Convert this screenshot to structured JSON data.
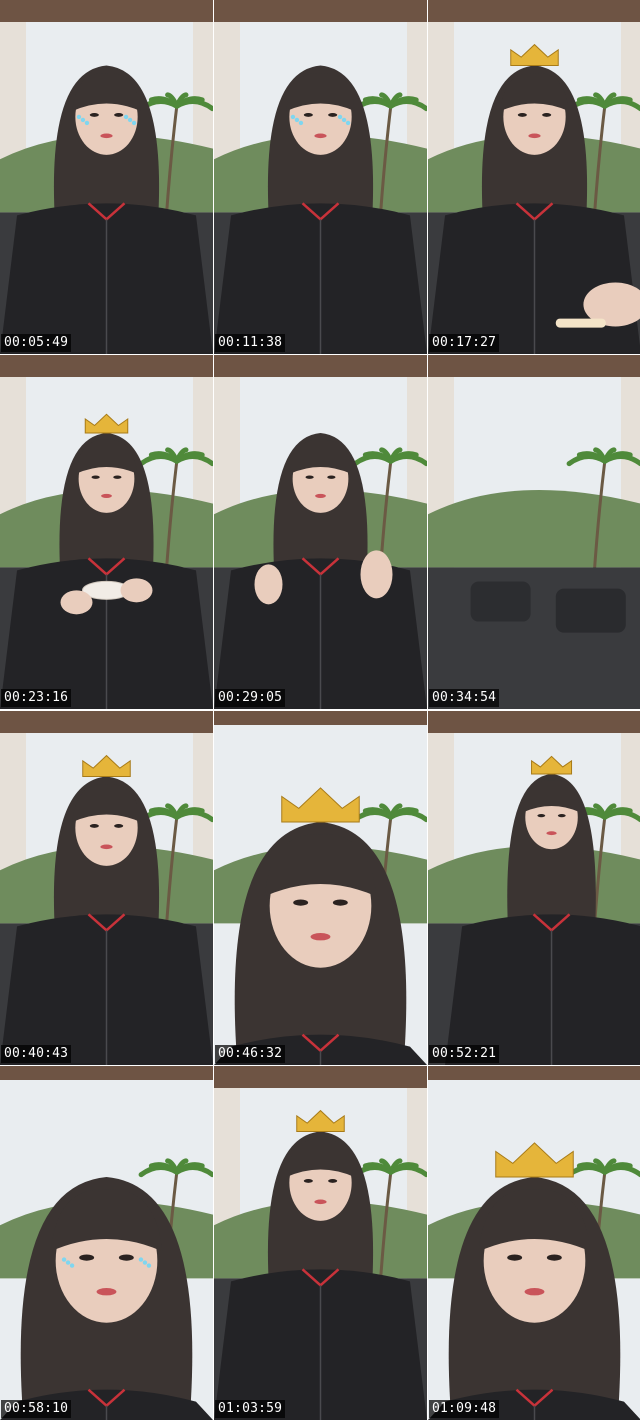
{
  "frames": [
    {
      "timestamp": "00:05:49",
      "crown": false,
      "sparkles": true,
      "scene": "sofa-face"
    },
    {
      "timestamp": "00:11:38",
      "crown": false,
      "sparkles": true,
      "scene": "sofa-face"
    },
    {
      "timestamp": "00:17:27",
      "crown": true,
      "sparkles": false,
      "scene": "hand-foreground"
    },
    {
      "timestamp": "00:23:16",
      "crown": true,
      "sparkles": false,
      "scene": "holding-cup"
    },
    {
      "timestamp": "00:29:05",
      "crown": false,
      "sparkles": false,
      "scene": "waving-hands"
    },
    {
      "timestamp": "00:34:54",
      "crown": false,
      "sparkles": false,
      "scene": "empty-sofa"
    },
    {
      "timestamp": "00:40:43",
      "crown": true,
      "sparkles": false,
      "scene": "sofa-face"
    },
    {
      "timestamp": "00:46:32",
      "crown": true,
      "sparkles": false,
      "scene": "close-face"
    },
    {
      "timestamp": "00:52:21",
      "crown": true,
      "sparkles": false,
      "scene": "side-look"
    },
    {
      "timestamp": "00:58:10",
      "crown": false,
      "sparkles": true,
      "scene": "close-face"
    },
    {
      "timestamp": "01:03:59",
      "crown": true,
      "sparkles": false,
      "scene": "sofa-face"
    },
    {
      "timestamp": "01:09:48",
      "crown": true,
      "sparkles": false,
      "scene": "close-face"
    }
  ],
  "colors": {
    "sky": "#e9edf0",
    "ceiling": "#6e5444",
    "pillar": "#e6e0d8",
    "sofa": "#3a3b3e",
    "hoodie": "#232326",
    "hair": "#3b3432",
    "skin": "#e9cdbd",
    "palm": "#4f8a3a",
    "crown": "#e5b53a",
    "accent-red": "#c8323a"
  }
}
